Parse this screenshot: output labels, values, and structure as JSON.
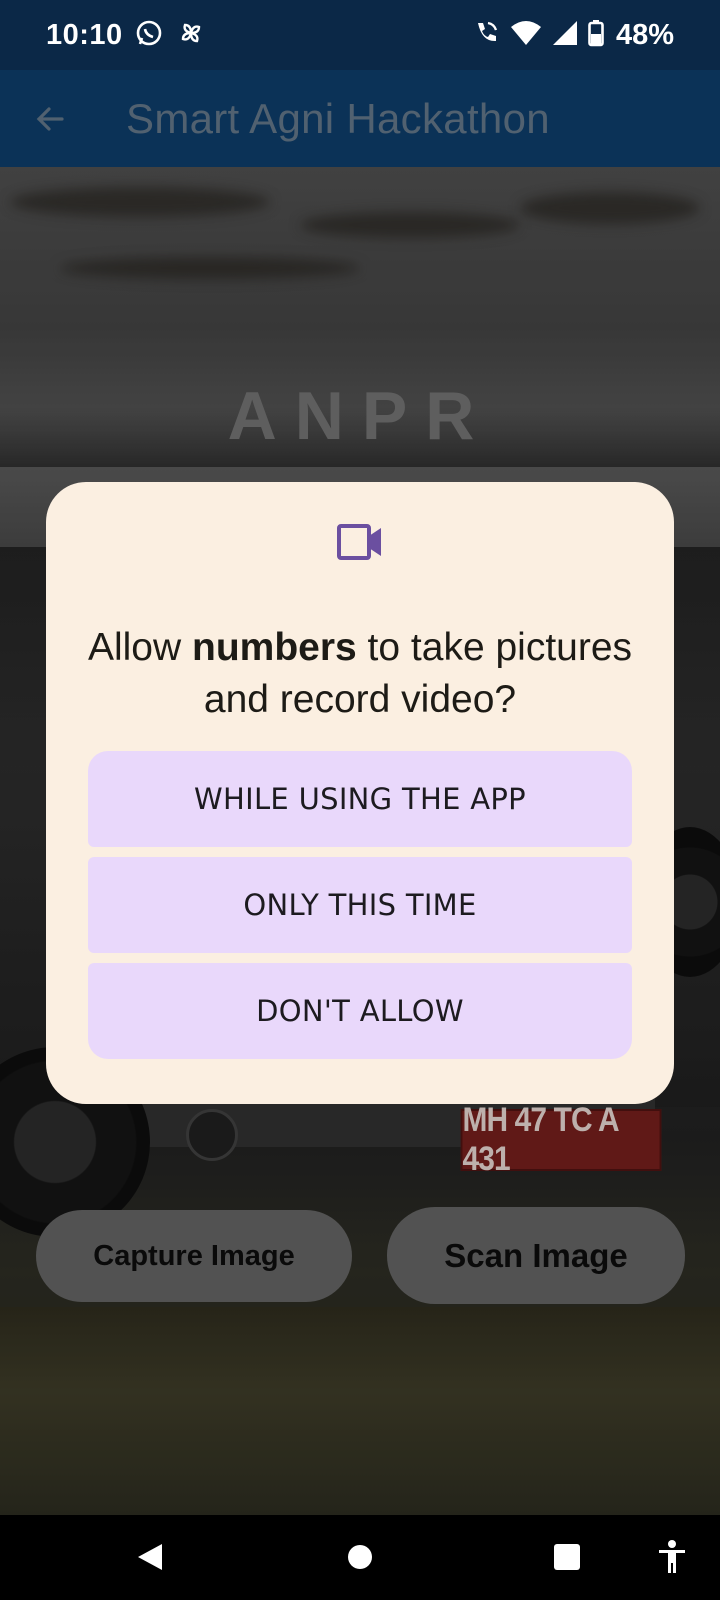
{
  "status_bar": {
    "time": "10:10",
    "battery": "48%",
    "left_icons": [
      "whatsapp-icon",
      "pinwheel-icon"
    ],
    "right_icons": [
      "wifi-call-icon",
      "wifi-icon",
      "signal-icon",
      "battery-icon"
    ]
  },
  "app_bar": {
    "title": "Smart Agni Hackathon",
    "back_icon": "arrow-back-icon"
  },
  "main": {
    "heading": "ANPR",
    "plate_text": "MH 47 TC A 431",
    "capture_button": "Capture Image",
    "scan_button": "Scan Image"
  },
  "dialog": {
    "icon": "videocam-icon",
    "title_prefix": "Allow ",
    "title_app": "numbers",
    "title_suffix": " to take pictures and record video?",
    "buttons": [
      {
        "label": "WHILE USING THE APP"
      },
      {
        "label": "ONLY THIS TIME"
      },
      {
        "label": "DON'T ALLOW"
      }
    ]
  },
  "nav_bar": {
    "items": [
      "back-triangle-icon",
      "home-circle-icon",
      "recents-square-icon",
      "accessibility-icon"
    ]
  },
  "colors": {
    "status_bar": "#0b2847",
    "app_bar": "#0d3a63",
    "dialog_bg": "#fbefe1",
    "dialog_button": "#e9d8fb",
    "icon_accent": "#6b4fa0"
  }
}
